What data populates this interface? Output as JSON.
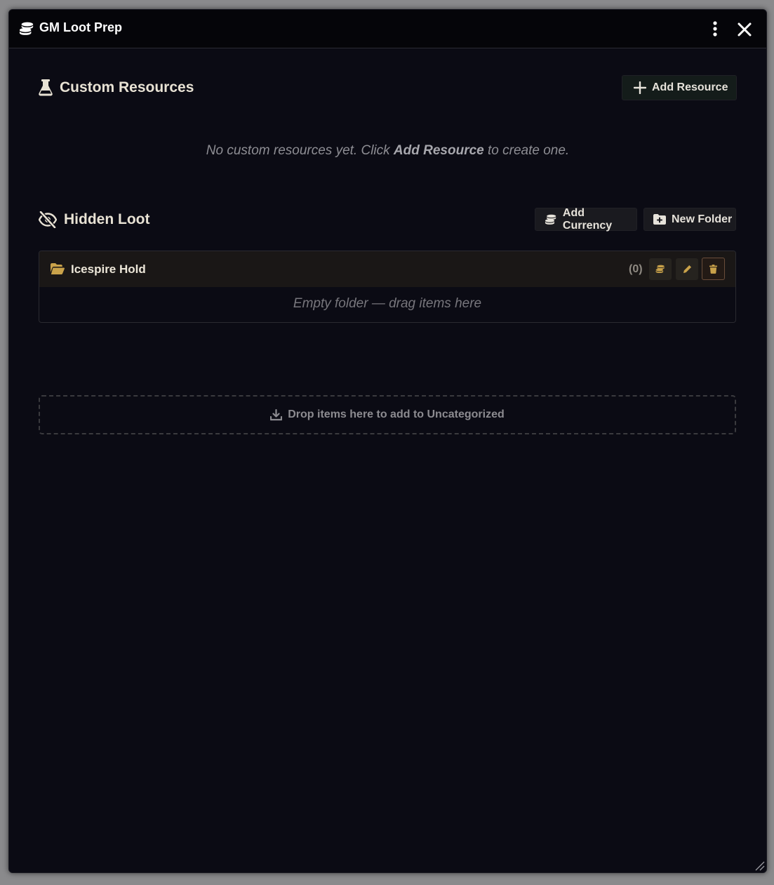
{
  "window": {
    "title": "GM Loot Prep",
    "title_icon": "coins-icon",
    "menu_icon": "vertical-ellipsis-icon",
    "close_icon": "close-icon"
  },
  "custom_resources": {
    "title": "Custom Resources",
    "icon": "flask-icon",
    "add_button_label": "Add Resource",
    "empty_prefix": "No custom resources yet. Click ",
    "empty_emph": "Add Resource",
    "empty_suffix": " to create one."
  },
  "hidden_loot": {
    "title": "Hidden Loot",
    "icon": "eye-slash-icon",
    "add_currency_label": "Add Currency",
    "new_folder_label": "New Folder",
    "folders": [
      {
        "name": "Icespire Hold",
        "count": "(0)",
        "empty_text": "Empty folder — drag items here"
      }
    ],
    "dropzone_text": "Drop items here to add to Uncategorized"
  },
  "colors": {
    "background": "#0b0b14",
    "titlebar": "#050509",
    "gold_accent": "#c9a24a",
    "text_light": "#e8e2d4"
  }
}
